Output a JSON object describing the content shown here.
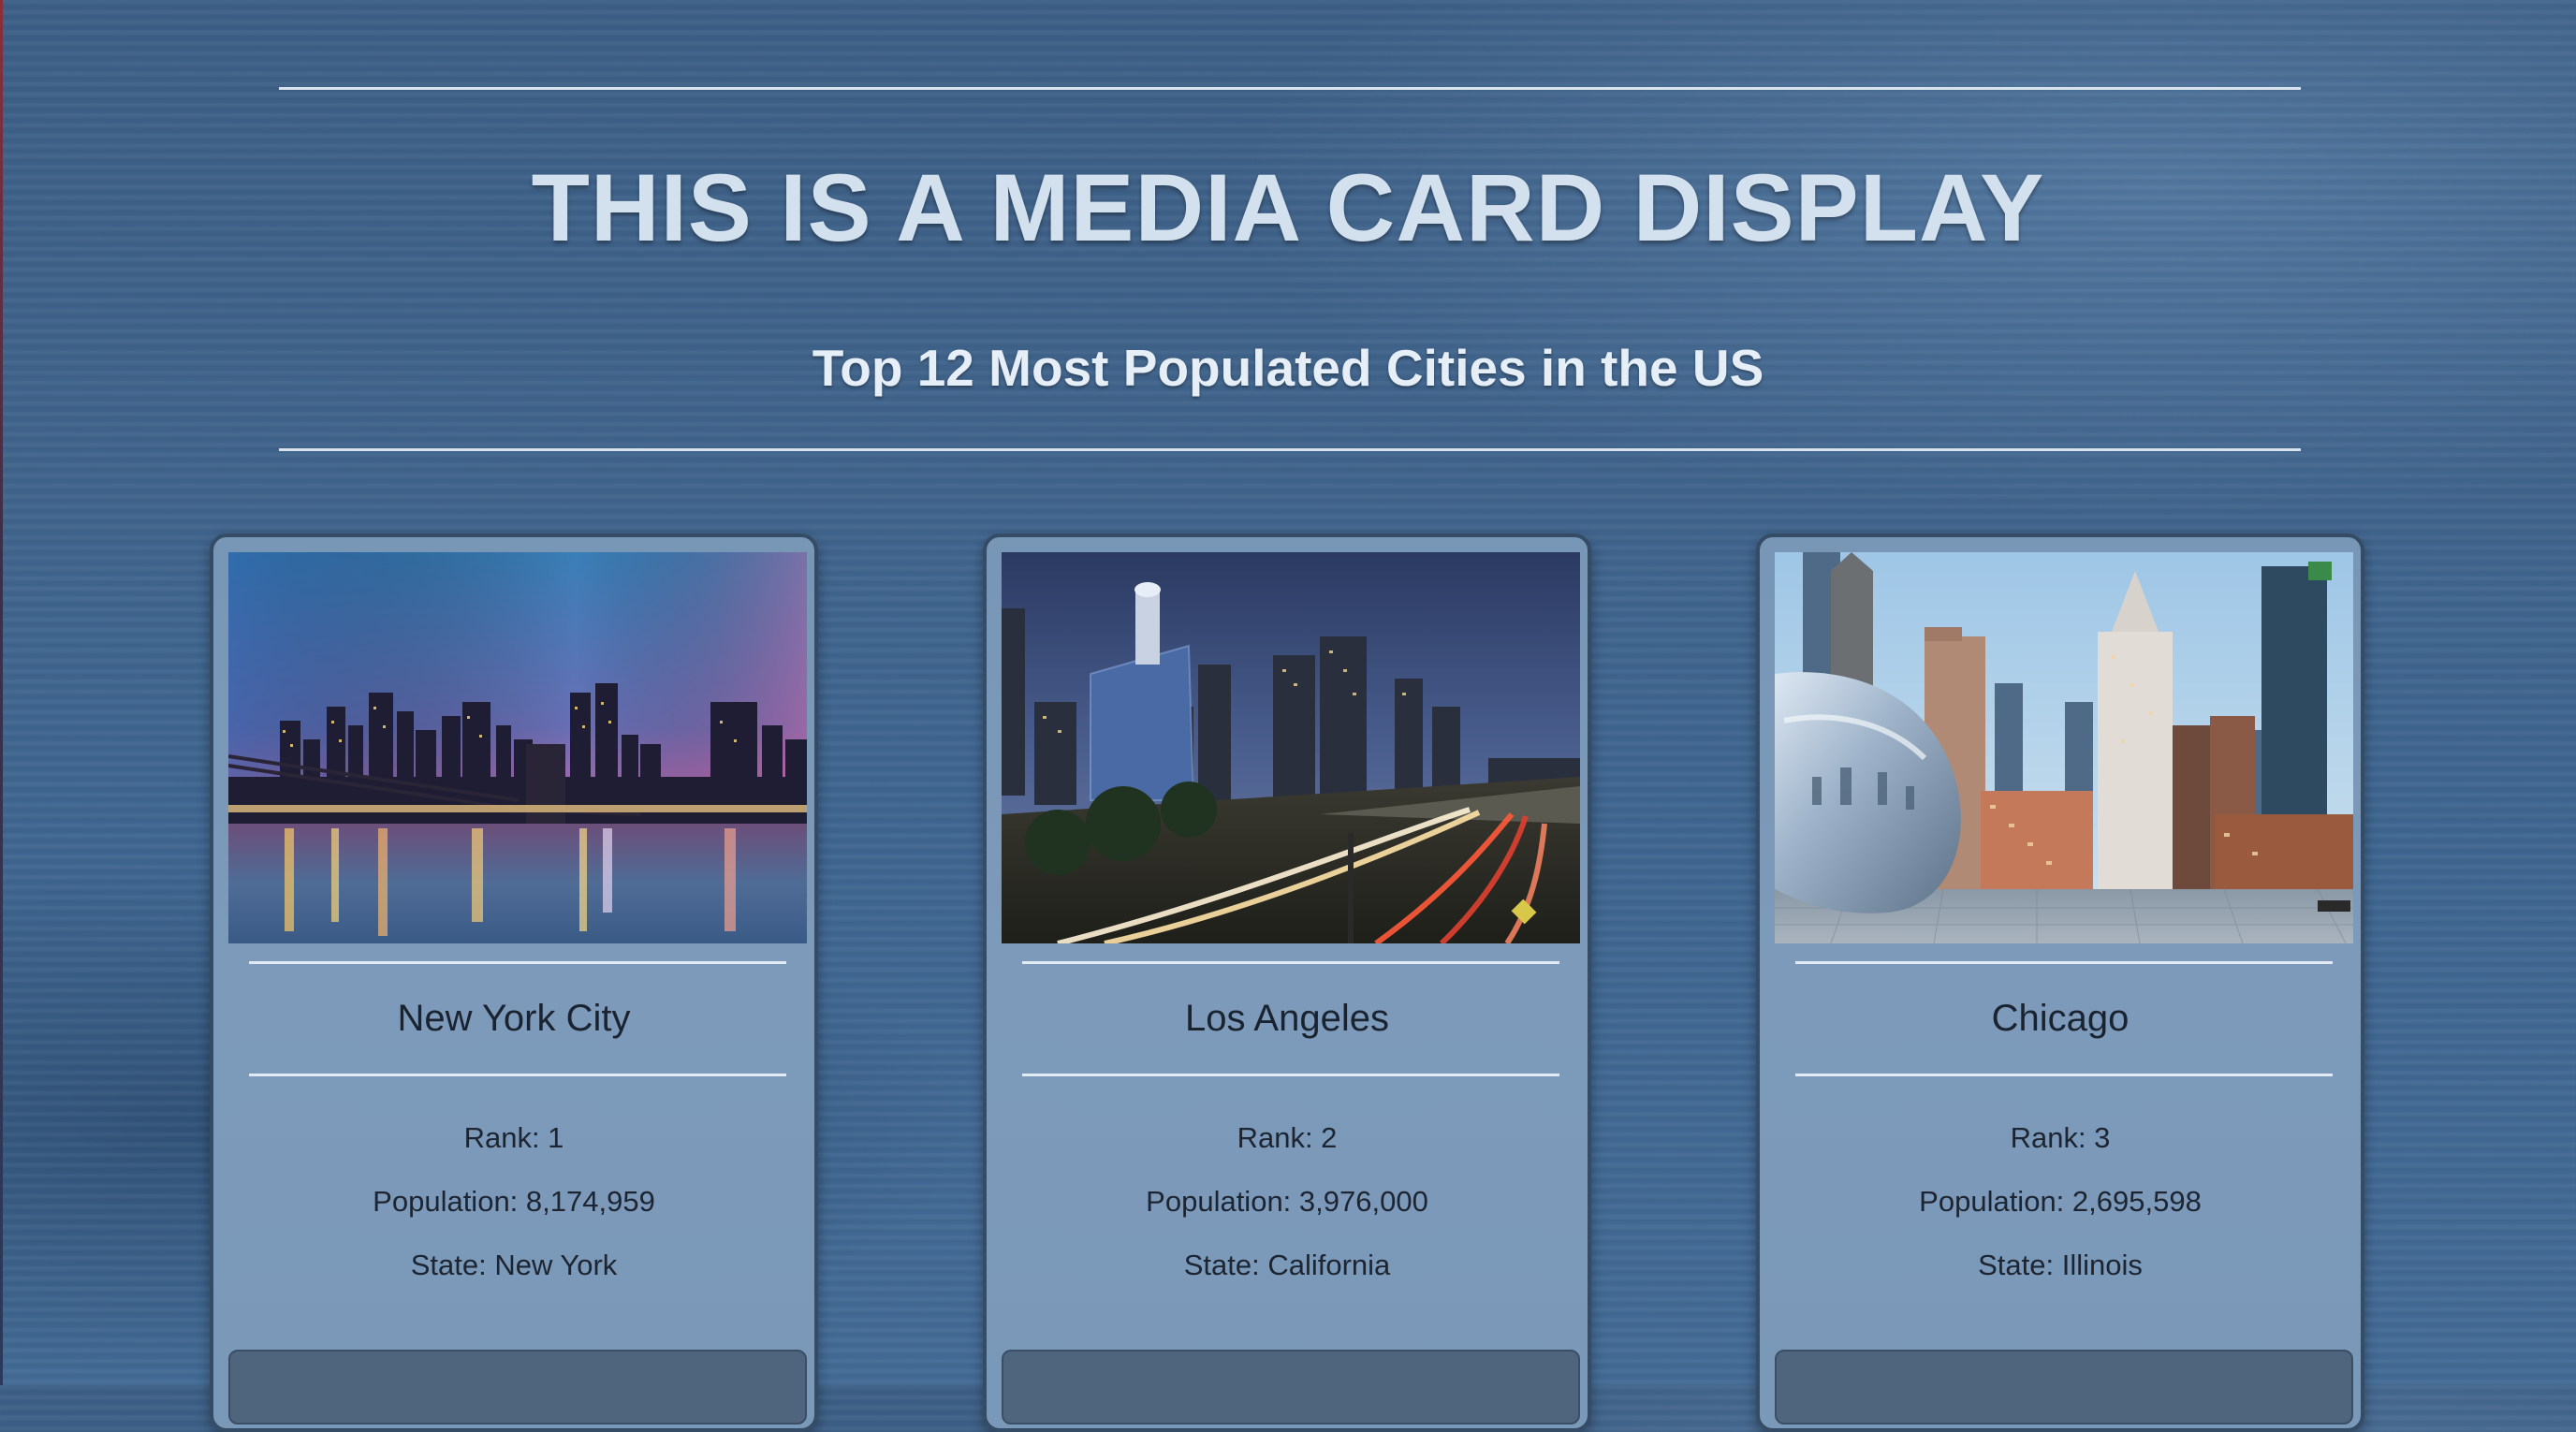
{
  "header": {
    "title": "THIS IS A MEDIA CARD DISPLAY",
    "subtitle": "Top 12 Most Populated Cities in the US"
  },
  "cards": [
    {
      "city": "New York City",
      "rank": "Rank: 1",
      "population": "Population: 8,174,959",
      "state": "State: New York",
      "image": "new-york-skyline-photo"
    },
    {
      "city": "Los Angeles",
      "rank": "Rank: 2",
      "population": "Population: 3,976,000",
      "state": "State: California",
      "image": "los-angeles-freeway-photo"
    },
    {
      "city": "Chicago",
      "rank": "Rank: 3",
      "population": "Population: 2,695,598",
      "state": "State: Illinois",
      "image": "chicago-bean-photo"
    }
  ],
  "colors": {
    "background": "#40648c",
    "title": "#d3e0ee",
    "card": "#7896b6",
    "card_border": "#354c66",
    "button": "#4f657e"
  }
}
